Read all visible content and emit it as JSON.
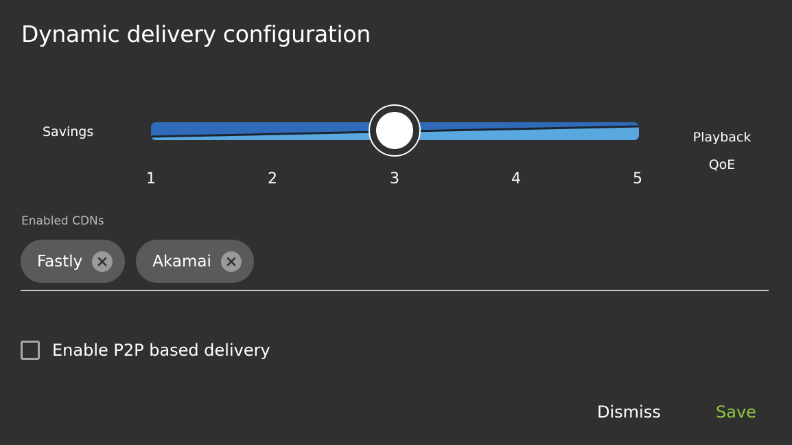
{
  "dialog": {
    "title": "Dynamic delivery configuration"
  },
  "slider": {
    "left_label": "Savings",
    "right_label_line1": "Playback",
    "right_label_line2": "QoE",
    "ticks": [
      "1",
      "2",
      "3",
      "4",
      "5"
    ],
    "value": 3,
    "min": 1,
    "max": 5,
    "track_color_top": "#2f6bb8",
    "track_color_bottom": "#5aa8e0"
  },
  "cdns": {
    "label": "Enabled CDNs",
    "items": [
      {
        "name": "Fastly",
        "remove_icon": "close-circle-icon"
      },
      {
        "name": "Akamai",
        "remove_icon": "close-circle-icon"
      }
    ]
  },
  "p2p": {
    "label": "Enable P2P based delivery",
    "checked": false
  },
  "actions": {
    "dismiss": "Dismiss",
    "save": "Save",
    "save_color": "#8cc63f"
  }
}
